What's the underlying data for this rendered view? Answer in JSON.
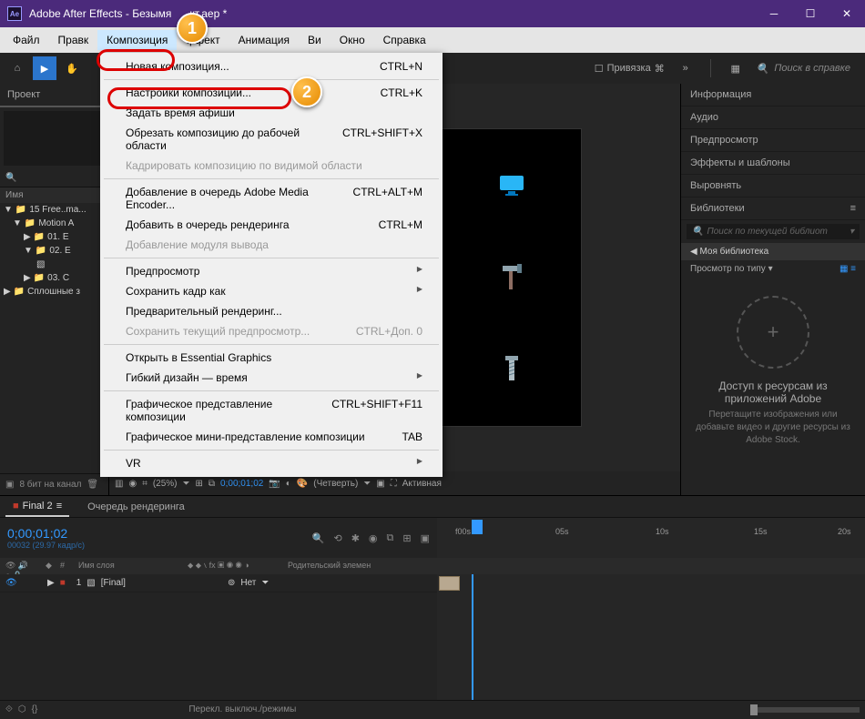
{
  "titlebar": {
    "app": "Adobe After Effects",
    "doc": "Безымя",
    "suffix": "кт.aep *",
    "logo": "Ae"
  },
  "menubar": {
    "items": [
      "Файл",
      "Правк",
      "Композиция",
      "ффект",
      "Анимация",
      "Ви",
      "Окно",
      "Справка"
    ],
    "active_index": 2
  },
  "toolbar": {
    "snap_label": "Привязка",
    "search_placeholder": "Поиск в справке"
  },
  "dropdown": {
    "items": [
      {
        "label": "Новая композиция...",
        "shortcut": "CTRL+N",
        "type": "item"
      },
      {
        "type": "sep"
      },
      {
        "label": "Настройки композиции...",
        "shortcut": "CTRL+K",
        "type": "item",
        "highlighted": true
      },
      {
        "label": "Задать время афиши",
        "shortcut": "",
        "type": "item"
      },
      {
        "label": "Обрезать композицию до рабочей области",
        "shortcut": "CTRL+SHIFT+X",
        "type": "item"
      },
      {
        "label": "Кадрировать композицию по видимой области",
        "shortcut": "",
        "type": "item",
        "disabled": true
      },
      {
        "type": "sep"
      },
      {
        "label": "Добавление в очередь Adobe Media Encoder...",
        "shortcut": "CTRL+ALT+M",
        "type": "item"
      },
      {
        "label": "Добавить в очередь рендеринга",
        "shortcut": "CTRL+M",
        "type": "item"
      },
      {
        "label": "Добавление модуля вывода",
        "shortcut": "",
        "type": "item",
        "disabled": true
      },
      {
        "type": "sep"
      },
      {
        "label": "Предпросмотр",
        "shortcut": "",
        "type": "submenu"
      },
      {
        "label": "Сохранить кадр как",
        "shortcut": "",
        "type": "submenu"
      },
      {
        "label": "Предварительный рендеринг...",
        "shortcut": "",
        "type": "item"
      },
      {
        "label": "Сохранить текущий предпросмотр...",
        "shortcut": "CTRL+Доп. 0",
        "type": "item",
        "disabled": true
      },
      {
        "type": "sep"
      },
      {
        "label": "Открыть в Essential Graphics",
        "shortcut": "",
        "type": "item"
      },
      {
        "label": "Гибкий дизайн — время",
        "shortcut": "",
        "type": "submenu"
      },
      {
        "type": "sep"
      },
      {
        "label": "Графическое представление композиции",
        "shortcut": "CTRL+SHIFT+F11",
        "type": "item"
      },
      {
        "label": "Графическое мини-представление композиции",
        "shortcut": "TAB",
        "type": "item"
      },
      {
        "type": "sep"
      },
      {
        "label": "VR",
        "shortcut": "",
        "type": "submenu"
      }
    ]
  },
  "project": {
    "tab": "Проект",
    "columns": {
      "name": "Имя"
    },
    "tree": [
      {
        "indent": 0,
        "icon": "folder",
        "label": "15 Free..ma..."
      },
      {
        "indent": 1,
        "icon": "folder",
        "label": "Motion A"
      },
      {
        "indent": 2,
        "icon": "folder",
        "label": "01. E"
      },
      {
        "indent": 2,
        "icon": "folder",
        "label": "02. E"
      },
      {
        "indent": 3,
        "icon": "comp",
        "label": ""
      },
      {
        "indent": 2,
        "icon": "folder",
        "label": "03. C"
      },
      {
        "indent": 0,
        "icon": "folder",
        "label": "Сплошные з"
      }
    ],
    "footer_bpc": "8 бит на канал"
  },
  "comp": {
    "footer": {
      "zoom": "(25%)",
      "tc": "0;00;01;02",
      "res": "(Четверть)",
      "active": "Активная"
    }
  },
  "right_panels": {
    "items": [
      "Информация",
      "Аудио",
      "Предпросмотр",
      "Эффекты и шаблоны",
      "Выровнять"
    ],
    "lib": {
      "title": "Библиотеки",
      "search": "Поиск по текущей библиот",
      "my_lib": "Моя библиотека",
      "filter": "Просмотр по типу",
      "drop_title": "Доступ к ресурсам из приложений Adobe",
      "drop_sub": "Перетащите изображения или добавьте видео и другие ресурсы из Adobe Stock."
    }
  },
  "timeline": {
    "tabs": {
      "active": "Final 2",
      "render": "Очередь рендеринга"
    },
    "timecode": "0;00;01;02",
    "timecode_sub": "00032 (29.97 кадр/с)",
    "col_head": {
      "layer_name": "Имя слоя",
      "mode": "⬥ ⬥ ∖ fx ▣ ◉ ◉ ◑",
      "parent": "Родительский элемен"
    },
    "layer": {
      "num": "1",
      "name": "[Final]",
      "parent_value": "Нет"
    },
    "marks": [
      "f00s",
      "05s",
      "10s",
      "15s",
      "20s"
    ],
    "footer_label": "Перекл. выключ./режимы"
  },
  "callouts": {
    "one": "1",
    "two": "2"
  }
}
